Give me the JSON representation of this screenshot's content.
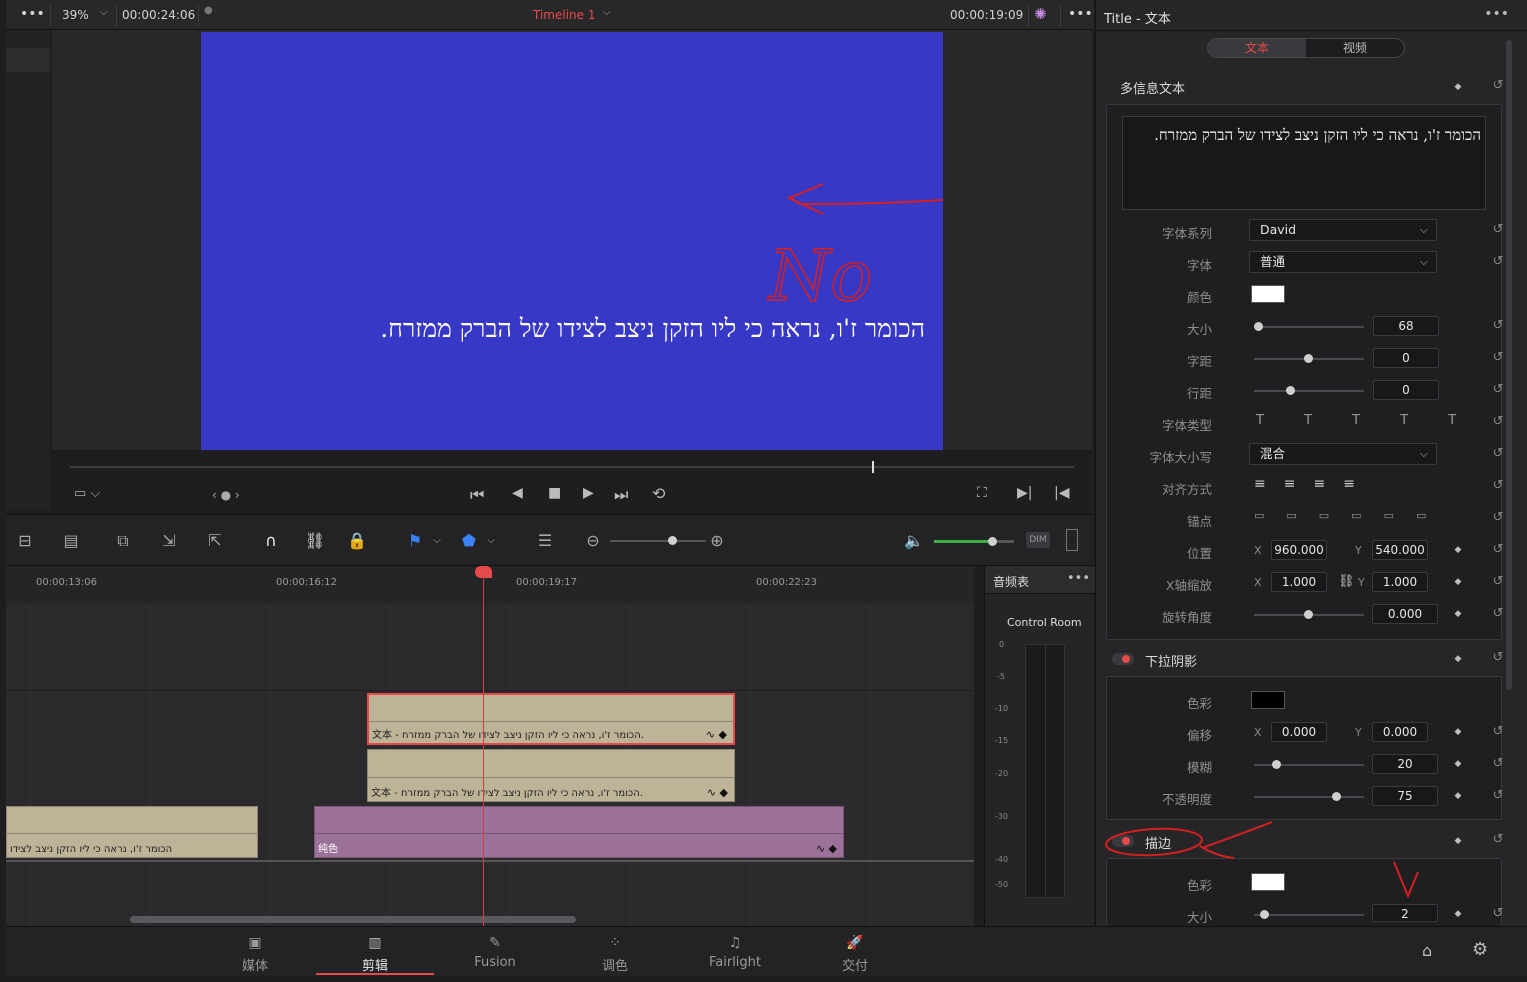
{
  "viewer": {
    "zoom": "39%",
    "timecode_left": "00:00:24:06",
    "timeline_name": "Timeline 1",
    "timecode_right": "00:00:19:09",
    "subtitle_text": "הכומר ז'ו, נראה כי ליו הזקן ניצב לצידו של הברק ממזרח.",
    "annotation_text": "No"
  },
  "timeline": {
    "ruler": [
      "00:00:13:06",
      "00:00:16:12",
      "00:00:19:17",
      "00:00:22:23"
    ],
    "clip_text_label": "文本 - הכומר ז'ו, נראה כי ליו הזקן ניצב לצידו של הברק ממזרח.",
    "clip_left_label": "הכומר ז'ו, נראה כי ליו הזקן ניצב לצידו",
    "clip_solid_label": "纯色",
    "dim_label": "DIM"
  },
  "audio_meter": {
    "tab": "音频表",
    "room": "Control Room",
    "scale": [
      "0",
      "-5",
      "-10",
      "-15",
      "-20",
      "-30",
      "-40",
      "-50"
    ]
  },
  "pages": [
    {
      "label": "媒体",
      "icon": "media-icon"
    },
    {
      "label": "剪辑",
      "icon": "edit-icon"
    },
    {
      "label": "Fusion",
      "icon": "fusion-icon"
    },
    {
      "label": "调色",
      "icon": "color-icon"
    },
    {
      "label": "Fairlight",
      "icon": "fairlight-icon"
    },
    {
      "label": "交付",
      "icon": "deliver-icon"
    }
  ],
  "inspector": {
    "title": "Title - 文本",
    "tabs": [
      "文本",
      "视频"
    ],
    "rich_text": {
      "header": "多信息文本",
      "content": "הכומר ז'ו, נראה כי ליו הזקן ניצב לצידו של הברק ממזרח."
    },
    "font_family_label": "字体系列",
    "font_family": "David",
    "font_label": "字体",
    "font": "普通",
    "color_label": "颜色",
    "size_label": "大小",
    "size": "68",
    "tracking_label": "字距",
    "tracking": "0",
    "line_spacing_label": "行距",
    "line_spacing": "0",
    "font_type_label": "字体类型",
    "case_label": "字体大小写",
    "case": "混合",
    "align_label": "对齐方式",
    "anchor_label": "锚点",
    "position_label": "位置",
    "pos_x": "960.000",
    "pos_y": "540.000",
    "zoom_label": "X轴缩放",
    "zoom_x": "1.000",
    "zoom_y": "1.000",
    "rotation_label": "旋转角度",
    "rotation": "0.000",
    "x_axis": "X",
    "y_axis": "Y",
    "drop_shadow": {
      "header": "下拉阴影",
      "color_label": "色彩",
      "offset_label": "偏移",
      "offset_x": "0.000",
      "offset_y": "0.000",
      "blur_label": "模糊",
      "blur": "20",
      "opacity_label": "不透明度",
      "opacity": "75"
    },
    "stroke": {
      "header": "描边",
      "color_label": "色彩",
      "size_label": "大小",
      "size": "2"
    }
  },
  "colors": {
    "accent_red": "#e84a4a",
    "frame_bg": "#3838c6",
    "clip_text": "#bdb397",
    "clip_solid": "#9b7199",
    "green_volume": "#3cb043"
  }
}
